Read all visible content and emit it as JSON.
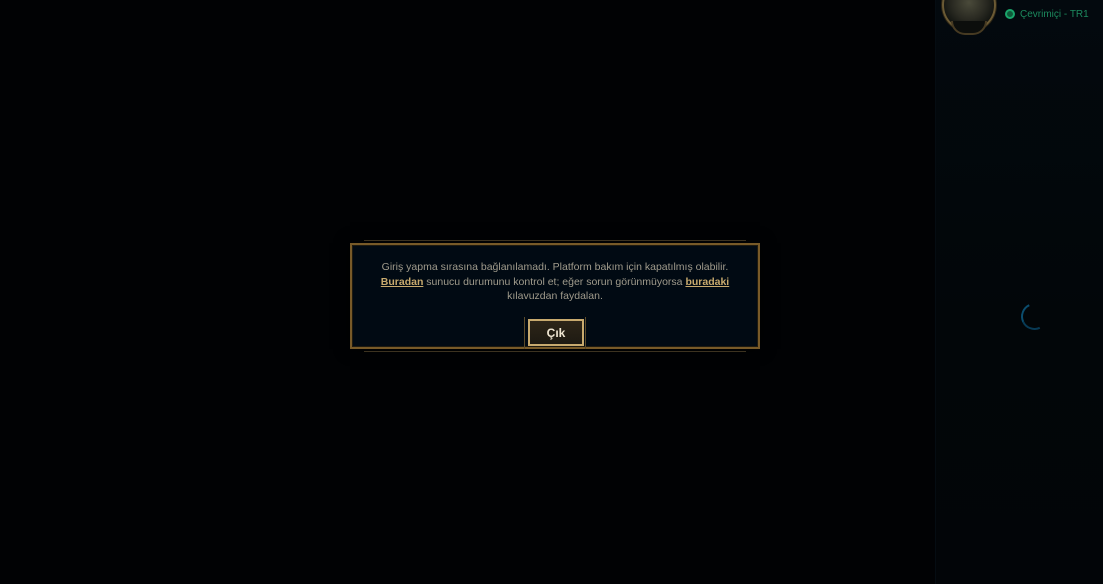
{
  "status": {
    "text": "Çevrimiçi - TR1",
    "color": "#1aa56b"
  },
  "dialog": {
    "message_line1": "Giriş yapma sırasına bağlanılamadı. Platform bakım için kapatılmış olabilir.",
    "link1": "Buradan",
    "message_line2_mid": " sunucu durumunu kontrol et; eğer sorun görünmüyorsa ",
    "link2": "buradaki",
    "message_line3": "kılavuzdan faydalan.",
    "button_label": "Çık"
  },
  "icons": {
    "avatar": "profile-avatar",
    "status": "online-status-icon",
    "spinner": "loading-spinner-icon"
  },
  "colors": {
    "accent_gold": "#c8aa6e",
    "dialog_bg": "#010a13",
    "text": "#a09b8c"
  }
}
